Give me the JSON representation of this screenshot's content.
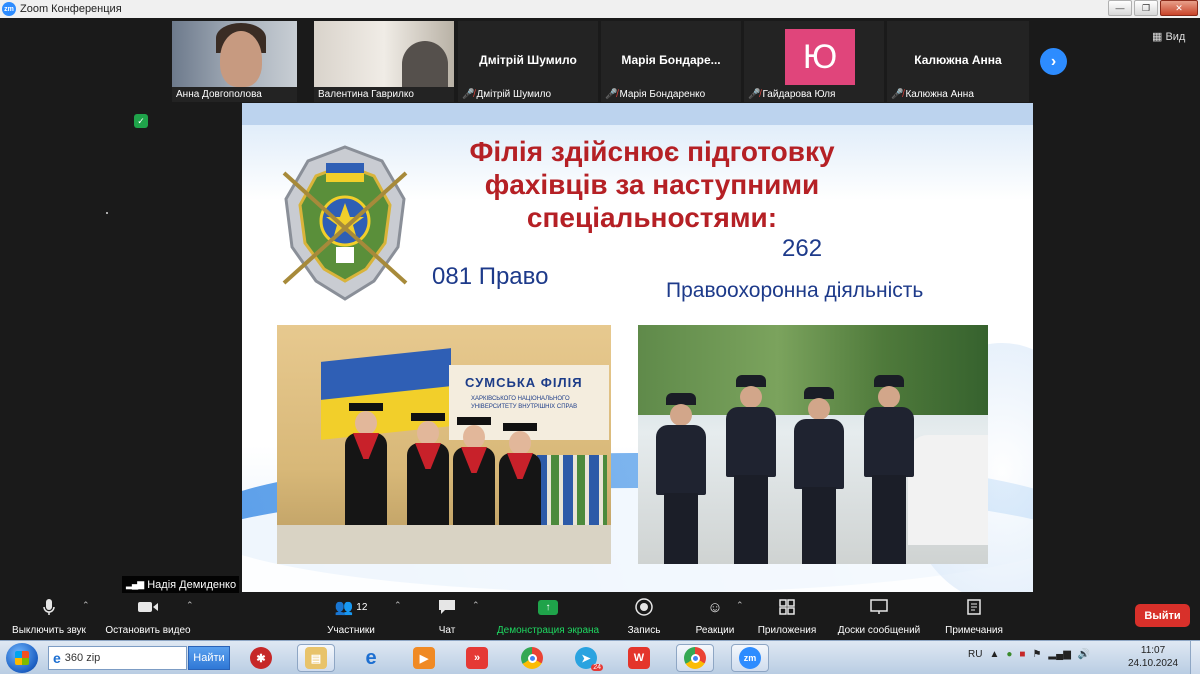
{
  "window": {
    "app_icon_text": "zm",
    "title": "Zoom Конференция",
    "controls": {
      "minimize": "—",
      "maximize": "❐",
      "close": "✕"
    }
  },
  "participants": [
    {
      "display": "video",
      "name": "Анна Довгополова",
      "muted": false
    },
    {
      "display": "video",
      "name": "Валентина Гаврилко",
      "muted": false
    },
    {
      "display": "name",
      "big_name": "Дмітрій Шумило",
      "name": "Дмітрій Шумило",
      "muted": true
    },
    {
      "display": "name",
      "big_name": "Марія Бондаре...",
      "name": "Марія Бондаренко",
      "muted": true
    },
    {
      "display": "avatar",
      "avatar_letter": "Ю",
      "name": "Гайдарова Юля",
      "muted": true
    },
    {
      "display": "name",
      "big_name": "Калюжна  Анна",
      "name": "Калюжна  Анна",
      "muted": true
    }
  ],
  "gallery": {
    "next_icon": "next-page-icon",
    "view_label": "Вид"
  },
  "active_speaker": {
    "name": "Надія Демиденко"
  },
  "slide": {
    "title": "Філія здійснює підготовку фахівців за наступними спеціальностями:",
    "spec1": "081 Право",
    "spec2_code": "262",
    "spec2_name": "Правоохоронна діяльність",
    "photo1_sign_title": "СУМСЬКА ФІЛІЯ",
    "photo1_sign_sub": "ХАРКІВСЬКОГО НАЦІОНАЛЬНОГО УНІВЕРСИТЕТУ ВНУТРІШНІХ СПРАВ"
  },
  "toolbar": {
    "mute": "Выключить звук",
    "stop_video": "Остановить видео",
    "participants": "Участники",
    "participants_count": "12",
    "chat": "Чат",
    "share": "Демонстрация экрана",
    "record": "Запись",
    "reactions": "Реакции",
    "apps": "Приложения",
    "whiteboards": "Доски сообщений",
    "notes": "Примечания",
    "leave": "Выйти"
  },
  "taskbar": {
    "search_value": "360 zip",
    "search_button": "Найти",
    "apps": [
      "ie-search-icon",
      "app-red-icon",
      "file-explorer-icon",
      "internet-explorer-icon",
      "media-player-icon",
      "anydesk-icon",
      "chrome-icon",
      "telegram-icon",
      "wps-office-icon",
      "chrome-profile-icon",
      "zoom-icon"
    ],
    "telegram_badge": "24",
    "language": "RU",
    "time": "11:07",
    "date": "24.10.2024"
  },
  "colors": {
    "zoom_blue": "#2d8cff",
    "leave_red": "#d8302a",
    "share_green": "#1ed760",
    "slide_title_red": "#b52025",
    "slide_text_blue": "#1d3a8a"
  }
}
